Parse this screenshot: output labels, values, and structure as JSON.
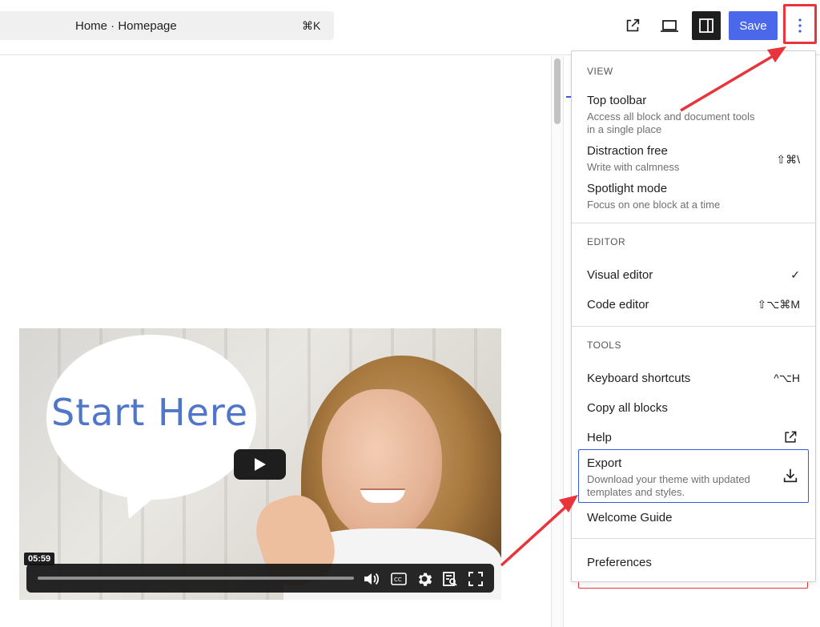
{
  "header": {
    "document_title": "Home · Homepage",
    "command_shortcut": "⌘K",
    "save_label": "Save",
    "icons": [
      "external-view-icon",
      "desktop-device-icon",
      "settings-panel-icon",
      "more-vertical-icon"
    ]
  },
  "video": {
    "overlay_text": "Start Here",
    "duration": "05:59",
    "controls": [
      "volume-icon",
      "closed-captions-icon",
      "settings-gear-icon",
      "watch-later-icon",
      "fullscreen-icon"
    ]
  },
  "menu": {
    "view": {
      "label": "VIEW",
      "items": [
        {
          "label": "Top toolbar",
          "description": "Access all block and document tools in a single place",
          "shortcut": ""
        },
        {
          "label": "Distraction free",
          "description": "Write with calmness",
          "shortcut": "⇧⌘\\"
        },
        {
          "label": "Spotlight mode",
          "description": "Focus on one block at a time",
          "shortcut": ""
        }
      ]
    },
    "editor": {
      "label": "EDITOR",
      "items": [
        {
          "label": "Visual editor",
          "shortcut": "✓"
        },
        {
          "label": "Code editor",
          "shortcut": "⇧⌥⌘M"
        }
      ]
    },
    "tools": {
      "label": "TOOLS",
      "items": [
        {
          "label": "Keyboard shortcuts",
          "shortcut": "^⌥H"
        },
        {
          "label": "Copy all blocks",
          "shortcut": ""
        },
        {
          "label": "Help",
          "icon": "external-link-icon"
        },
        {
          "label": "Export",
          "description": "Download your theme with updated templates and styles.",
          "icon": "download-icon"
        },
        {
          "label": "Welcome Guide",
          "shortcut": ""
        }
      ]
    },
    "preferences": {
      "label": "Preferences"
    }
  },
  "colors": {
    "accent": "#3858e9",
    "annotation_red": "#e8343a",
    "dark": "#1e1e1e"
  }
}
